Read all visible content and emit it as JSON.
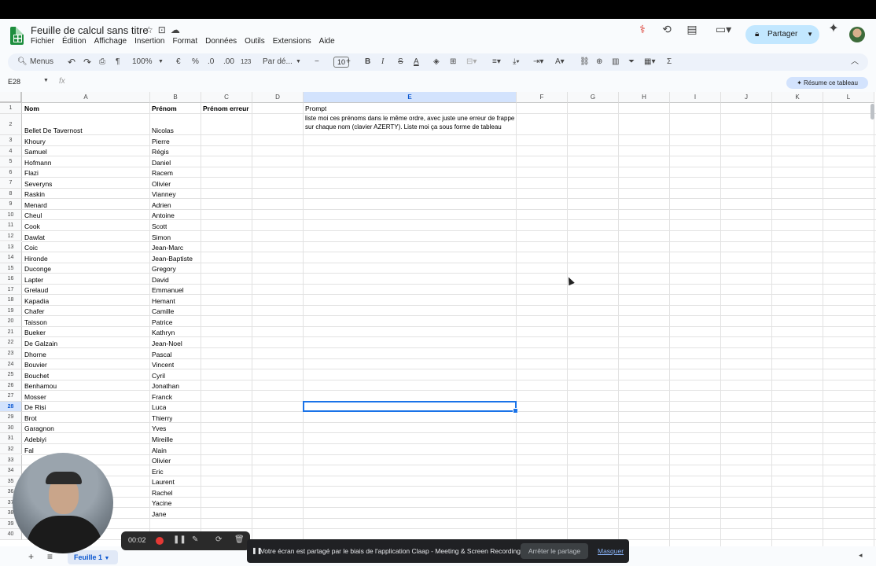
{
  "app": {
    "doc_title": "Feuille de calcul sans titre",
    "menu": [
      "Fichier",
      "Édition",
      "Affichage",
      "Insertion",
      "Format",
      "Données",
      "Outils",
      "Extensions",
      "Aide"
    ],
    "share_label": "Partager"
  },
  "toolbar": {
    "search_label": "Menus",
    "zoom": "100%",
    "currency": "€",
    "percent": "%",
    "dec_decrease": ".0",
    "dec_increase": ".00",
    "num_format": "123",
    "font_name": "Par dé...",
    "font_size": "10",
    "minus": "−",
    "plus": "+",
    "bold": "B",
    "italic": "I",
    "strike": "S",
    "text_color": "A",
    "sigma": "Σ"
  },
  "formula_bar": {
    "name_box": "E28",
    "fx": "fx",
    "summary_label": "Résume ce tableau"
  },
  "grid": {
    "columns": [
      "A",
      "B",
      "C",
      "D",
      "E",
      "F",
      "G",
      "H",
      "I",
      "J",
      "K",
      "L"
    ],
    "headers": {
      "nom": "Nom",
      "prenom": "Prénom",
      "prenom_erreur": "Prénom erreur",
      "prompt": "Prompt"
    },
    "prompt_text": "liste moi ces prénoms dans le même ordre, avec juste une erreur de frappe sur chaque nom (clavier AZERTY). Liste moi ça sous forme de tableau",
    "rows": [
      {
        "n": "2",
        "nom": "Bellet De Tavernost",
        "prenom": "Nicolas"
      },
      {
        "n": "3",
        "nom": "Khoury",
        "prenom": "Pierre"
      },
      {
        "n": "4",
        "nom": "Samuel",
        "prenom": "Régis"
      },
      {
        "n": "5",
        "nom": "Hofmann",
        "prenom": "Daniel"
      },
      {
        "n": "6",
        "nom": "Flazi",
        "prenom": "Racem"
      },
      {
        "n": "7",
        "nom": "Severyns",
        "prenom": "Olivier"
      },
      {
        "n": "8",
        "nom": "Raskin",
        "prenom": "Vianney"
      },
      {
        "n": "9",
        "nom": "Menard",
        "prenom": "Adrien"
      },
      {
        "n": "10",
        "nom": "Cheul",
        "prenom": "Antoine"
      },
      {
        "n": "11",
        "nom": "Cook",
        "prenom": "Scott"
      },
      {
        "n": "12",
        "nom": "Dawlat",
        "prenom": "Simon"
      },
      {
        "n": "13",
        "nom": "Coic",
        "prenom": "Jean-Marc"
      },
      {
        "n": "14",
        "nom": "Hironde",
        "prenom": "Jean-Baptiste"
      },
      {
        "n": "15",
        "nom": "Duconge",
        "prenom": "Gregory"
      },
      {
        "n": "16",
        "nom": "Lapter",
        "prenom": "David"
      },
      {
        "n": "17",
        "nom": "Grelaud",
        "prenom": "Emmanuel"
      },
      {
        "n": "18",
        "nom": "Kapadia",
        "prenom": "Hemant"
      },
      {
        "n": "19",
        "nom": "Chafer",
        "prenom": "Camille"
      },
      {
        "n": "20",
        "nom": "Taisson",
        "prenom": "Patrice"
      },
      {
        "n": "21",
        "nom": "Bueker",
        "prenom": "Kathryn"
      },
      {
        "n": "22",
        "nom": "De Galzain",
        "prenom": "Jean-Noel"
      },
      {
        "n": "23",
        "nom": "Dhorne",
        "prenom": "Pascal"
      },
      {
        "n": "24",
        "nom": "Bouvier",
        "prenom": "Vincent"
      },
      {
        "n": "25",
        "nom": "Bouchet",
        "prenom": "Cyril"
      },
      {
        "n": "26",
        "nom": "Benhamou",
        "prenom": "Jonathan"
      },
      {
        "n": "27",
        "nom": "Mosser",
        "prenom": "Franck"
      },
      {
        "n": "28",
        "nom": "De Risi",
        "prenom": "Luca"
      },
      {
        "n": "29",
        "nom": "Brot",
        "prenom": "Thierry"
      },
      {
        "n": "30",
        "nom": "Garagnon",
        "prenom": "Yves"
      },
      {
        "n": "31",
        "nom": "Adebiyi",
        "prenom": "Mireille"
      },
      {
        "n": "32",
        "nom": "Fal",
        "prenom": "Alain"
      },
      {
        "n": "33",
        "nom": "",
        "prenom": "Olivier"
      },
      {
        "n": "34",
        "nom": "",
        "prenom": "Eric"
      },
      {
        "n": "35",
        "nom": "",
        "prenom": "Laurent"
      },
      {
        "n": "36",
        "nom": "",
        "prenom": "Rachel"
      },
      {
        "n": "37",
        "nom": "",
        "prenom": "Yacine"
      },
      {
        "n": "38",
        "nom": "",
        "prenom": "Jane"
      },
      {
        "n": "39",
        "nom": "",
        "prenom": ""
      },
      {
        "n": "40",
        "nom": "",
        "prenom": ""
      }
    ]
  },
  "sheet": {
    "tab_label": "Feuille 1"
  },
  "recorder": {
    "time": "00:02"
  },
  "banner": {
    "text": "Votre écran est partagé par le biais de l'application Claap - Meeting & Screen Recording.",
    "stop_label": "Arrêter le partage",
    "hide_label": "Masquer"
  },
  "colors": {
    "accent": "#1a73e8",
    "share_bg": "#c2e7ff",
    "sheets_green": "#1e8e3e"
  }
}
